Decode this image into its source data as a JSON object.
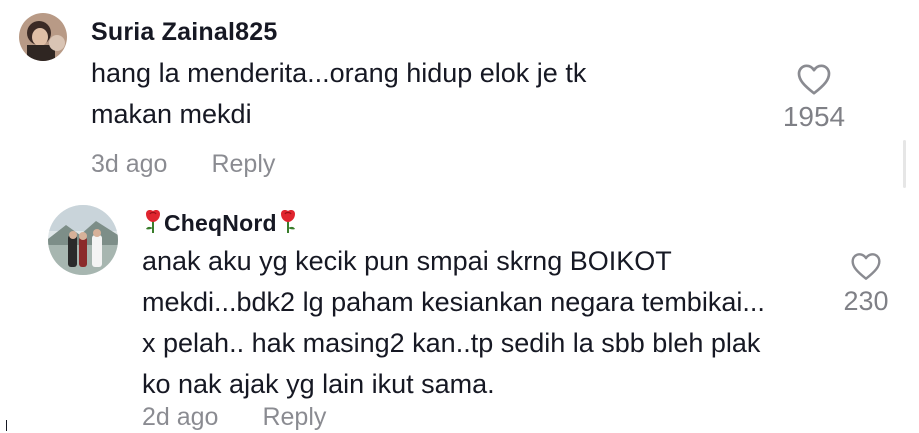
{
  "comments": [
    {
      "username": "Suria Zainal825",
      "lines": [
        "hang la menderita...orang hidup elok je tk",
        "makan mekdi"
      ],
      "time": "3d ago",
      "reply_label": "Reply",
      "likes": "1954"
    },
    {
      "username": "CheqNord",
      "lines": [
        "anak aku yg kecik pun smpai skrng BOIKOT",
        "mekdi...bdk2 lg paham kesiankan negara tembikai...",
        "x pelah.. hak masing2 kan..tp sedih la sbb bleh plak",
        "ko nak ajak yg lain ikut sama."
      ],
      "time": "2d ago",
      "reply_label": "Reply",
      "likes": "230"
    }
  ],
  "icons": {
    "like": "heart-outline-icon",
    "username_decoration": "rose-icon"
  },
  "colors": {
    "text": "#161823",
    "muted": "#8a8b91",
    "rose": "#e0252f"
  }
}
